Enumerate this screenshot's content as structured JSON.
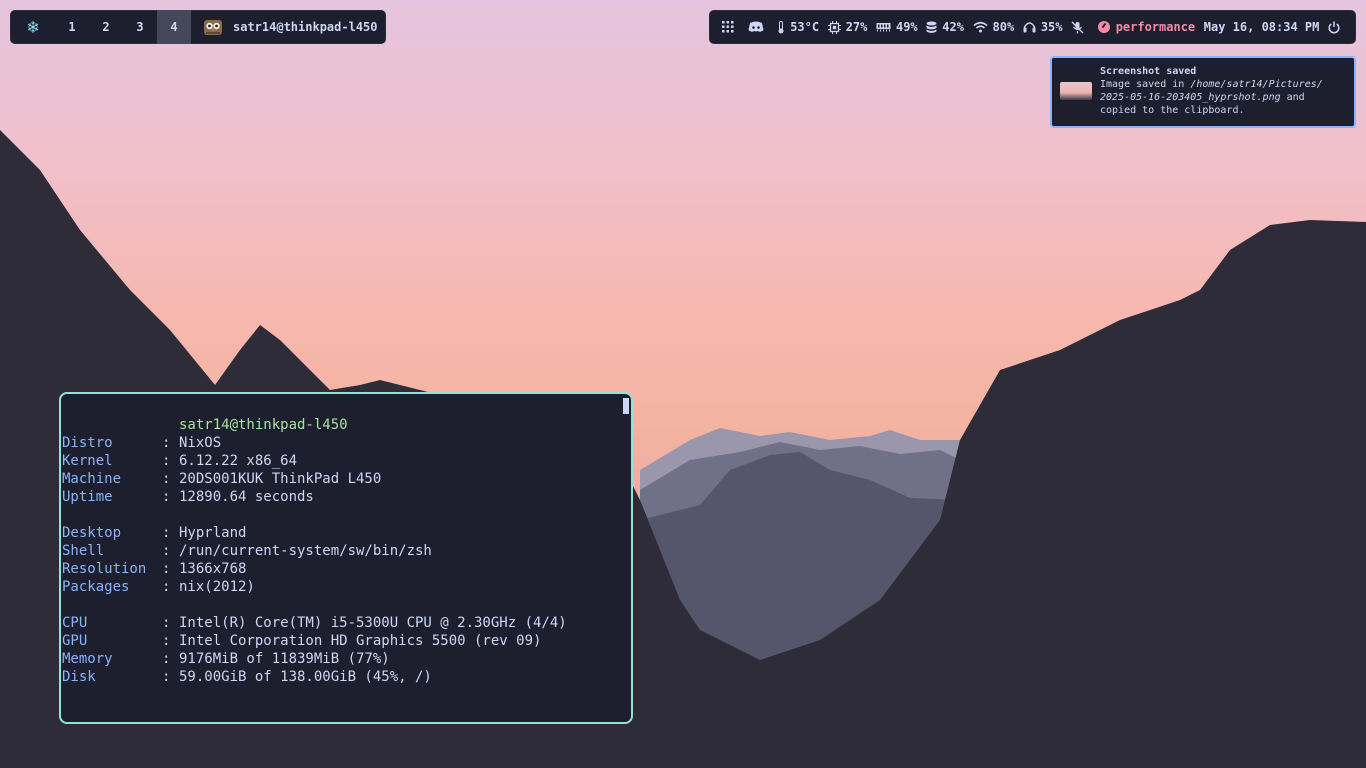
{
  "topbar_left": {
    "logo_icon": "nixos-snowflake-icon",
    "workspaces": [
      "1",
      "2",
      "3",
      "4"
    ],
    "active_workspace": "4",
    "window_title": "satr14@thinkpad-l450"
  },
  "topbar_right": {
    "temperature": "53°C",
    "cpu": "27%",
    "memory": "49%",
    "disk": "42%",
    "wifi": "80%",
    "volume": "35%",
    "power_profile": "performance",
    "datetime": "May 16, 08:34 PM"
  },
  "notification": {
    "title": "Screenshot saved",
    "body_prefix": "Image saved in ",
    "path": "/home/satr14/Pictures/ 2025-05-16-203405_hyprshot.png",
    "body_suffix": " and copied to the clipboard."
  },
  "terminal": {
    "user_host": "satr14@thinkpad-l450",
    "separator": ":",
    "rows": [
      {
        "key": "Distro",
        "value": "NixOS"
      },
      {
        "key": "Kernel",
        "value": "6.12.22 x86_64"
      },
      {
        "key": "Machine",
        "value": "20DS001KUK ThinkPad L450"
      },
      {
        "key": "Uptime",
        "value": "12890.64 seconds"
      },
      {
        "key": "Desktop",
        "value": "Hyprland"
      },
      {
        "key": "Shell",
        "value": "/run/current-system/sw/bin/zsh"
      },
      {
        "key": "Resolution",
        "value": "1366x768"
      },
      {
        "key": "Packages",
        "value": "nix(2012)"
      },
      {
        "key": "CPU",
        "value": "Intel(R) Core(TM) i5-5300U CPU @ 2.30GHz (4/4)"
      },
      {
        "key": "GPU",
        "value": "Intel Corporation HD Graphics 5500 (rev 09)"
      },
      {
        "key": "Memory",
        "value": "9176MiB of 11839MiB (77%)"
      },
      {
        "key": "Disk",
        "value": "59.00GiB of 138.00GiB (45%, /)"
      }
    ]
  },
  "colors": {
    "bar_bg": "#1e1f2e",
    "terminal_border": "#94e2d5",
    "notification_border": "#89b4fa",
    "accent_pink": "#f38ba8",
    "key_blue": "#89b4fa",
    "user_green": "#a6e3a1"
  }
}
